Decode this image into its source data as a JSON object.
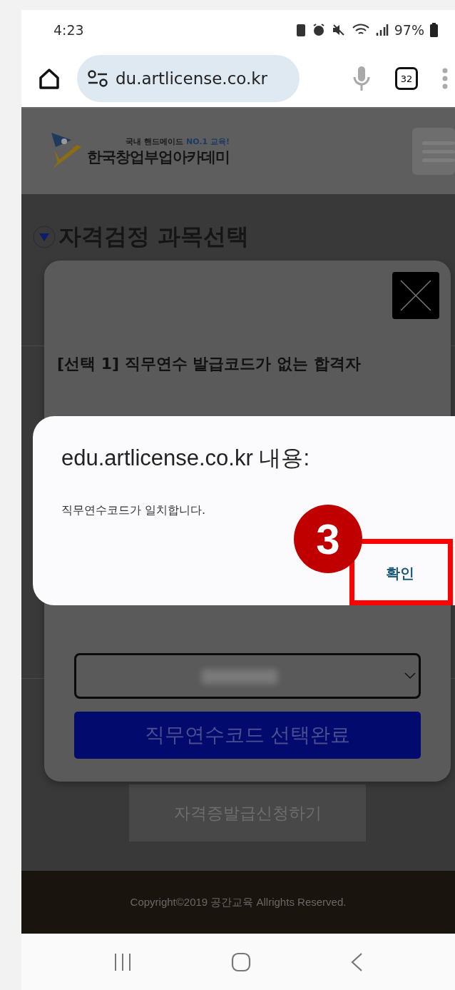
{
  "status_bar": {
    "time": "4:23",
    "battery": "97%"
  },
  "browser": {
    "url": "du.artlicense.co.kr",
    "tab_count": "32"
  },
  "site": {
    "tagline": "국내 핸드메이드 **NO.1 교육!**",
    "name": "한국창업부업아카데미",
    "section_title": "자격검정 과목선택",
    "apply_button": "자격증발급신청하기",
    "copyright": "Copyright©2019 공간교육 Allrights Reserved."
  },
  "modal": {
    "option_heading": "[선택 1] 직무연수 발급코드가 없는 합격자",
    "submit_button": "직무연수코드 선택완료"
  },
  "alert": {
    "title": "edu.artlicense.co.kr 내용:",
    "message": "직무연수코드가 일치합니다.",
    "confirm_button": "확인"
  },
  "annotation": {
    "step": "3"
  }
}
